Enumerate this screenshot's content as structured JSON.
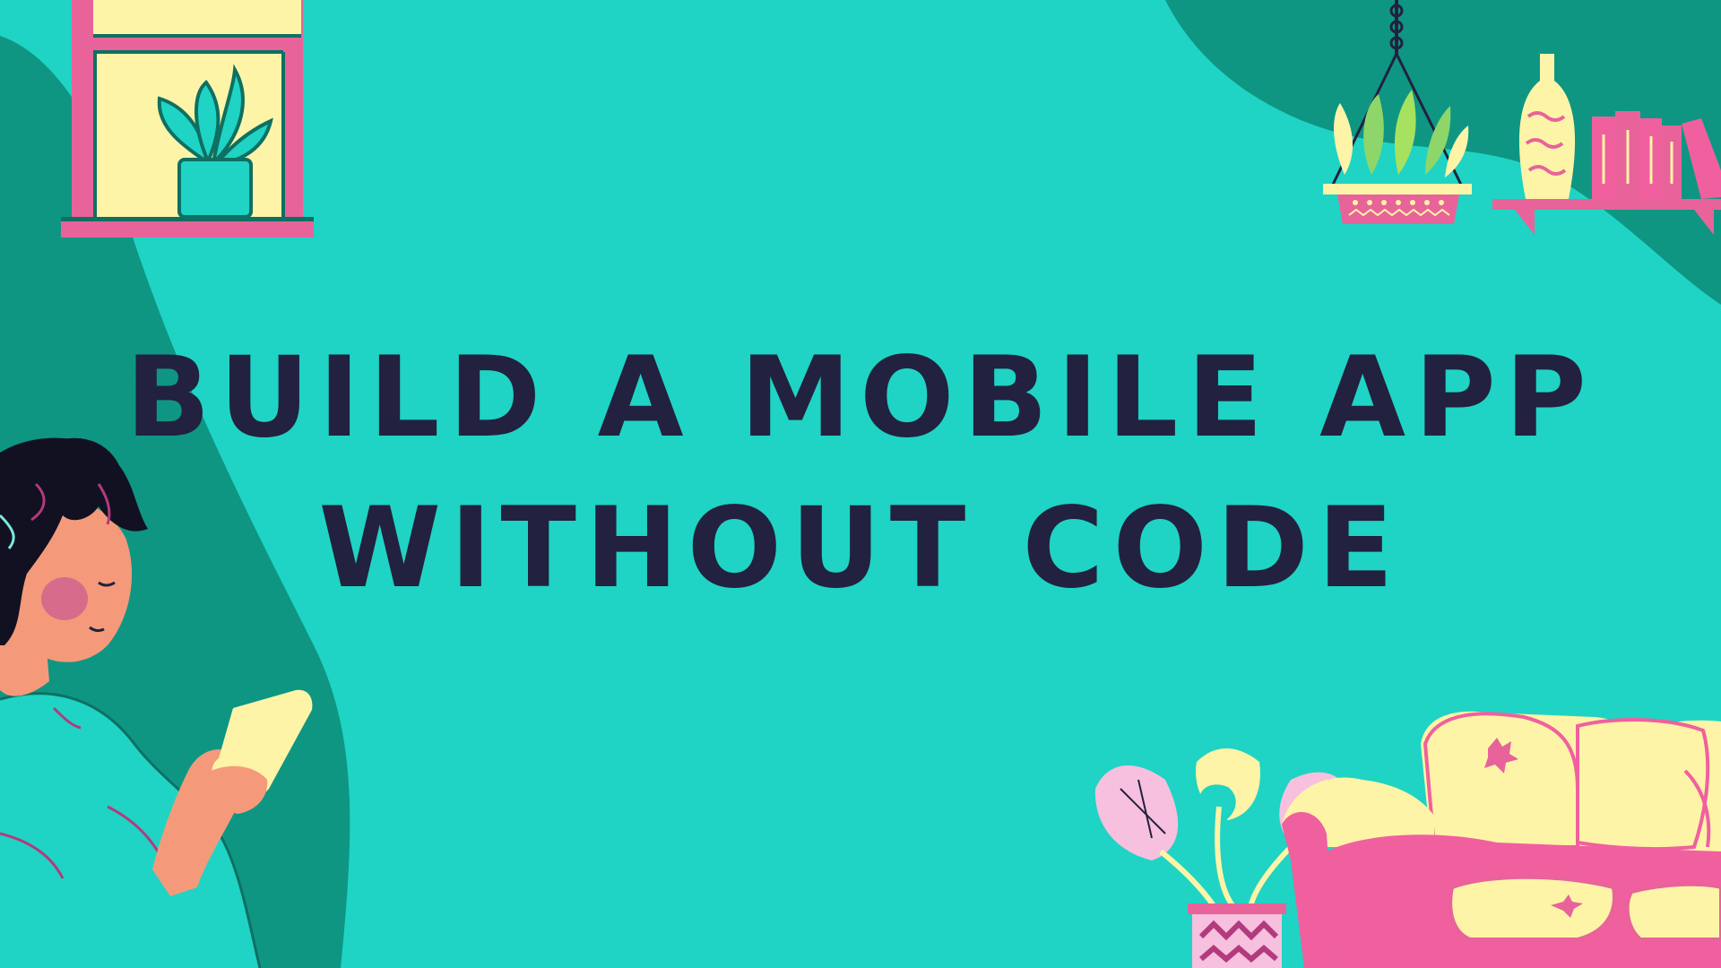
{
  "headline": {
    "line1": "BUILD A MOBILE APP",
    "line2": "WITHOUT CODE"
  },
  "colors": {
    "background": "#1fd4c4",
    "dark_teal": "#0e9683",
    "text": "#22213f",
    "pink": "#e8639a",
    "hot_pink": "#f0609e",
    "cream": "#fdf4a7",
    "light_pink": "#f6c0de",
    "skin": "#f49a7a"
  },
  "illustrations": [
    "window-plant-icon",
    "hanging-plant-icon",
    "shelf-vase-books-icon",
    "woman-reading-phone-icon",
    "monstera-plant-icon",
    "pink-sofa-icon"
  ]
}
